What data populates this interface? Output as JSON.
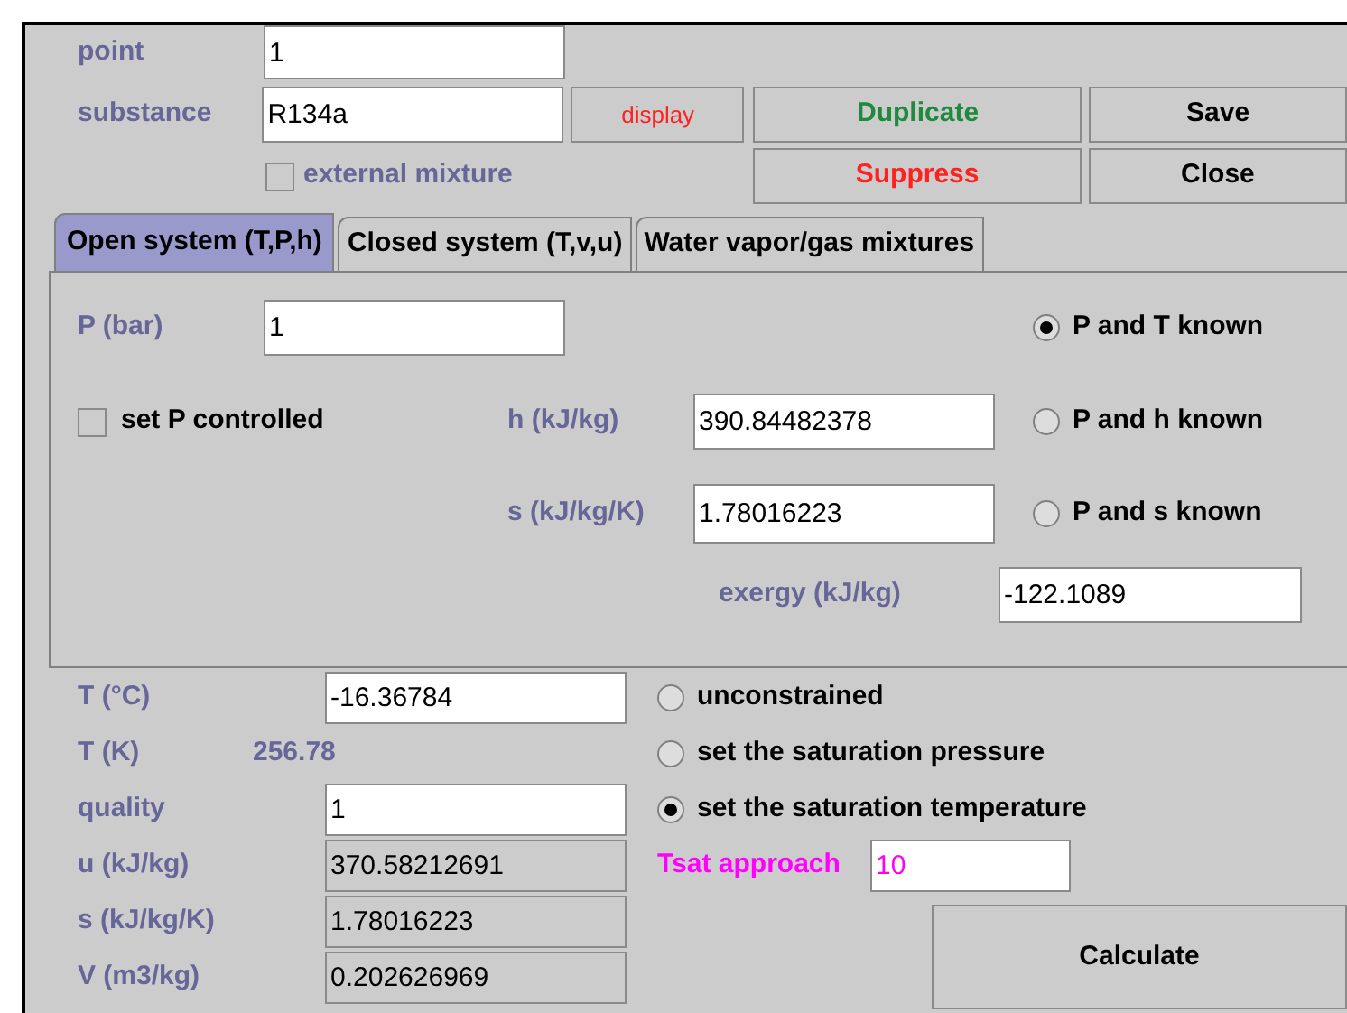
{
  "header": {
    "point": {
      "label": "point",
      "value": "1"
    },
    "substance": {
      "label": "substance",
      "value": "R134a"
    },
    "display_button": "display",
    "buttons": [
      {
        "label": "Duplicate",
        "color": "#1f8a3c"
      },
      {
        "label": "Save",
        "color": "#000000"
      },
      {
        "label": "Suppress",
        "color": "#ff2020"
      },
      {
        "label": "Close",
        "color": "#000000"
      }
    ],
    "external_mixture": {
      "label": "external mixture",
      "checked": false
    }
  },
  "tabs": [
    {
      "label": "Open system (T,P,h)",
      "selected": true
    },
    {
      "label": "Closed system (T,v,u)",
      "selected": false
    },
    {
      "label": "Water vapor/gas mixtures",
      "selected": false
    }
  ],
  "panel": {
    "pressure": {
      "label": "P (bar)",
      "value": "1"
    },
    "set_p_controlled": {
      "label": "set P controlled",
      "checked": false
    },
    "enthalpy": {
      "label": "h (kJ/kg)",
      "value": "390.84482378"
    },
    "entropy": {
      "label": "s (kJ/kg/K)",
      "value": "1.78016223"
    },
    "exergy": {
      "label": "exergy (kJ/kg)",
      "value": "-122.1089"
    },
    "modes": [
      {
        "label": "P and T known",
        "selected": true
      },
      {
        "label": "P and h known",
        "selected": false
      },
      {
        "label": "P and s known",
        "selected": false
      }
    ]
  },
  "properties": [
    {
      "kind": "field",
      "label": "T (°C)",
      "value": "-16.36784",
      "editable": true
    },
    {
      "kind": "text",
      "label": "T (K)",
      "value": "256.78"
    },
    {
      "kind": "field",
      "label": "quality",
      "value": "1",
      "editable": true
    },
    {
      "kind": "field",
      "label": "u (kJ/kg)",
      "value": "370.58212691",
      "editable": false
    },
    {
      "kind": "field",
      "label": "s (kJ/kg/K)",
      "value": "1.78016223",
      "editable": false
    },
    {
      "kind": "field",
      "label": "V (m3/kg)",
      "value": "0.202626969",
      "editable": false
    }
  ],
  "constraints": [
    {
      "label": "unconstrained",
      "selected": false
    },
    {
      "label": "set the saturation pressure",
      "selected": false
    },
    {
      "label": "set the saturation temperature",
      "selected": true
    }
  ],
  "tsat_approach": {
    "label": "Tsat approach",
    "value": "10"
  },
  "calculate_button": "Calculate"
}
